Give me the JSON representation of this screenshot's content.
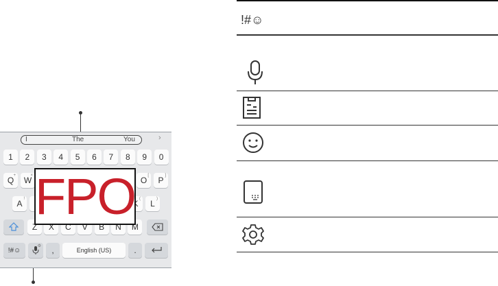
{
  "keyboard": {
    "suggestions": [
      "I",
      "The",
      "You"
    ],
    "number_row": [
      "1",
      "2",
      "3",
      "4",
      "5",
      "6",
      "7",
      "8",
      "9",
      "0"
    ],
    "row_q": [
      {
        "key": "Q",
        "sub": "+"
      },
      {
        "key": "W",
        "sub": "×"
      },
      {
        "key": "O",
        "sub": "["
      },
      {
        "key": "P",
        "sub": "]"
      }
    ],
    "row_a": [
      {
        "key": "A",
        "sub": "!"
      },
      {
        "key": "S",
        "sub": ""
      },
      {
        "key": "K",
        "sub": "("
      },
      {
        "key": "L",
        "sub": ")"
      }
    ],
    "row_z": [
      "Z",
      "X",
      "C",
      "V",
      "B",
      "N",
      "M"
    ],
    "symbol_key": "!#☺",
    "comma_key": ",",
    "space_label": "English (US)",
    "period_key": ".",
    "placeholder_label": "FPO"
  },
  "table": {
    "rows": [
      {
        "icon": "symbols-icon",
        "text": "!#☺"
      },
      {
        "icon": "microphone-icon"
      },
      {
        "icon": "clipboard-icon"
      },
      {
        "icon": "emoji-icon"
      },
      {
        "icon": "keyboard-size-icon"
      },
      {
        "icon": "settings-icon"
      }
    ]
  }
}
